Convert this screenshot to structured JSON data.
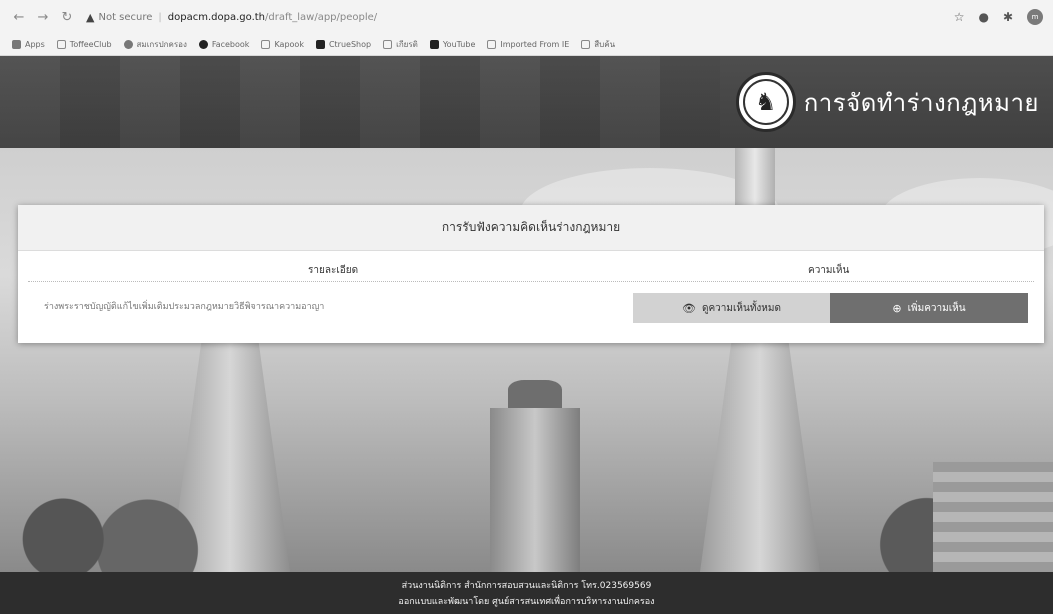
{
  "browser": {
    "url_warning": "Not secure",
    "url_host": "dopacm.dopa.go.th",
    "url_path": "/draft_law/app/people/",
    "profile_initials": "m"
  },
  "bookmarks": [
    {
      "label": "Apps",
      "icon": "apps-grid-icon"
    },
    {
      "label": "ToffeeClub",
      "icon": "toffee-icon"
    },
    {
      "label": "สมเกรปกครอง",
      "icon": "site-icon"
    },
    {
      "label": "Facebook",
      "icon": "facebook-icon"
    },
    {
      "label": "Kapook",
      "icon": "kapook-icon"
    },
    {
      "label": "CtrueShop",
      "icon": "shop-icon"
    },
    {
      "label": "เกียรติ",
      "icon": "bird-icon"
    },
    {
      "label": "YouTube",
      "icon": "youtube-icon"
    },
    {
      "label": "Imported From IE",
      "icon": "folder-icon"
    },
    {
      "label": "สืบค้น",
      "icon": "page-icon"
    }
  ],
  "header": {
    "site_title": "การจัดทำร่างกฎหมาย"
  },
  "card": {
    "title": "การรับฟังความคิดเห็นร่างกฎหมาย",
    "detail_heading": "รายละเอียด",
    "comment_heading": "ความเห็น",
    "detail_text": "ร่างพระราชบัญญัติแก้ไขเพิ่มเติมประมวลกฎหมายวิธีพิจารณาความอาญา",
    "view_all_label": "ดูความเห็นทั้งหมด",
    "add_comment_label": "เพิ่มความเห็น"
  },
  "footer": {
    "line1": "ส่วนงานนิติการ สำนักการสอบสวนและนิติการ โทร.023569569",
    "line2": "ออกแบบและพัฒนาโดย ศูนย์สารสนเทศเพื่อการบริหารงานปกครอง"
  },
  "colors": {
    "header_bg": "#444444",
    "footer_bg": "#2d2d2d",
    "view_button_bg": "#d2d2d2",
    "add_button_bg": "#6f6f6f"
  }
}
